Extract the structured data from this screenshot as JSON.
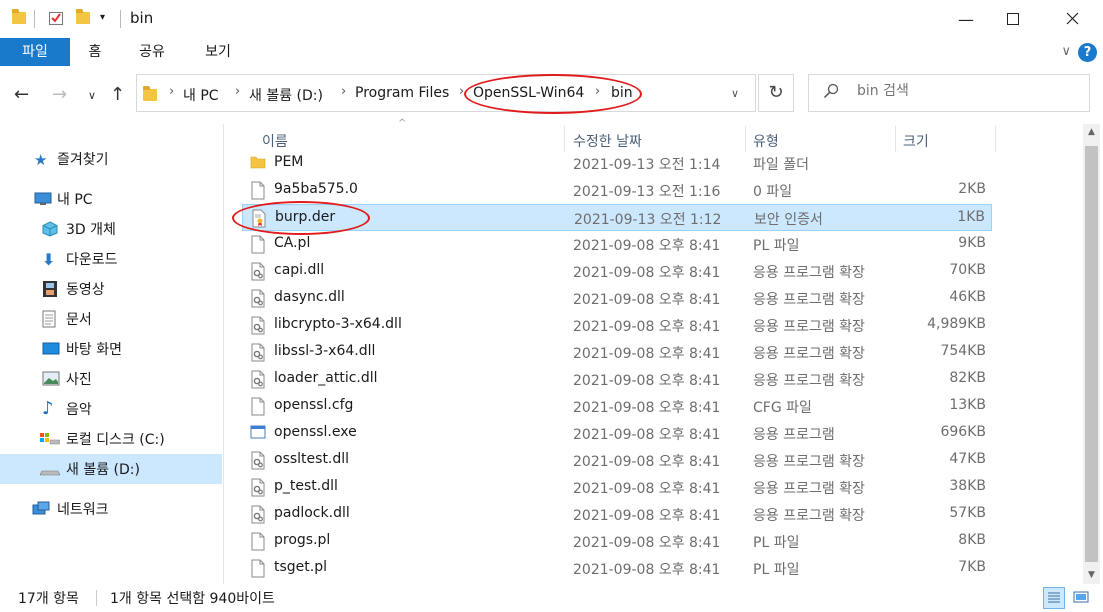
{
  "titlebar": {
    "title": "bin",
    "minimize_icon": "minimize-icon",
    "maximize_icon": "maximize-icon",
    "close_icon": "close-icon"
  },
  "ribbon": {
    "tabs": [
      "파일",
      "홈",
      "공유",
      "보기"
    ],
    "help_label": "?"
  },
  "address": {
    "crumbs": [
      "내 PC",
      "새 볼륨 (D:)",
      "Program Files",
      "OpenSSL-Win64",
      "bin"
    ],
    "search_placeholder": "bin 검색"
  },
  "nav": {
    "items": [
      {
        "label": "즐겨찾기",
        "icon": "star-icon"
      },
      {
        "label": "내 PC",
        "icon": "computer-icon"
      },
      {
        "label": "3D 개체",
        "icon": "cube-icon"
      },
      {
        "label": "다운로드",
        "icon": "download-icon"
      },
      {
        "label": "동영상",
        "icon": "video-icon"
      },
      {
        "label": "문서",
        "icon": "document-icon"
      },
      {
        "label": "바탕 화면",
        "icon": "desktop-icon"
      },
      {
        "label": "사진",
        "icon": "picture-icon"
      },
      {
        "label": "음악",
        "icon": "music-icon"
      },
      {
        "label": "로컬 디스크 (C:)",
        "icon": "drive-icon"
      },
      {
        "label": "새 볼륨 (D:)",
        "icon": "drive-icon"
      },
      {
        "label": "네트워크",
        "icon": "network-icon"
      }
    ]
  },
  "columns": {
    "name": "이름",
    "date": "수정한 날짜",
    "type": "유형",
    "size": "크기"
  },
  "files": [
    {
      "name": "PEM",
      "date": "2021-09-13 오전 1:14",
      "type": "파일 폴더",
      "size": "",
      "icon": "folder-icon"
    },
    {
      "name": "9a5ba575.0",
      "date": "2021-09-13 오전 1:16",
      "type": "0 파일",
      "size": "2KB",
      "icon": "file-icon"
    },
    {
      "name": "burp.der",
      "date": "2021-09-13 오전 1:12",
      "type": "보안 인증서",
      "size": "1KB",
      "icon": "certificate-icon"
    },
    {
      "name": "CA.pl",
      "date": "2021-09-08 오후 8:41",
      "type": "PL 파일",
      "size": "9KB",
      "icon": "file-icon"
    },
    {
      "name": "capi.dll",
      "date": "2021-09-08 오후 8:41",
      "type": "응용 프로그램 확장",
      "size": "70KB",
      "icon": "dll-icon"
    },
    {
      "name": "dasync.dll",
      "date": "2021-09-08 오후 8:41",
      "type": "응용 프로그램 확장",
      "size": "46KB",
      "icon": "dll-icon"
    },
    {
      "name": "libcrypto-3-x64.dll",
      "date": "2021-09-08 오후 8:41",
      "type": "응용 프로그램 확장",
      "size": "4,989KB",
      "icon": "dll-icon"
    },
    {
      "name": "libssl-3-x64.dll",
      "date": "2021-09-08 오후 8:41",
      "type": "응용 프로그램 확장",
      "size": "754KB",
      "icon": "dll-icon"
    },
    {
      "name": "loader_attic.dll",
      "date": "2021-09-08 오후 8:41",
      "type": "응용 프로그램 확장",
      "size": "82KB",
      "icon": "dll-icon"
    },
    {
      "name": "openssl.cfg",
      "date": "2021-09-08 오후 8:41",
      "type": "CFG 파일",
      "size": "13KB",
      "icon": "file-icon"
    },
    {
      "name": "openssl.exe",
      "date": "2021-09-08 오후 8:41",
      "type": "응용 프로그램",
      "size": "696KB",
      "icon": "exe-icon"
    },
    {
      "name": "ossltest.dll",
      "date": "2021-09-08 오후 8:41",
      "type": "응용 프로그램 확장",
      "size": "47KB",
      "icon": "dll-icon"
    },
    {
      "name": "p_test.dll",
      "date": "2021-09-08 오후 8:41",
      "type": "응용 프로그램 확장",
      "size": "38KB",
      "icon": "dll-icon"
    },
    {
      "name": "padlock.dll",
      "date": "2021-09-08 오후 8:41",
      "type": "응용 프로그램 확장",
      "size": "57KB",
      "icon": "dll-icon"
    },
    {
      "name": "progs.pl",
      "date": "2021-09-08 오후 8:41",
      "type": "PL 파일",
      "size": "8KB",
      "icon": "file-icon"
    },
    {
      "name": "tsget.pl",
      "date": "2021-09-08 오후 8:41",
      "type": "PL 파일",
      "size": "7KB",
      "icon": "file-icon"
    }
  ],
  "status": {
    "item_count": "17개 항목",
    "selection": "1개 항목 선택함 940바이트"
  },
  "colors": {
    "accent": "#1979ca",
    "selection": "#cce8ff",
    "annotation": "#e01b1b"
  }
}
